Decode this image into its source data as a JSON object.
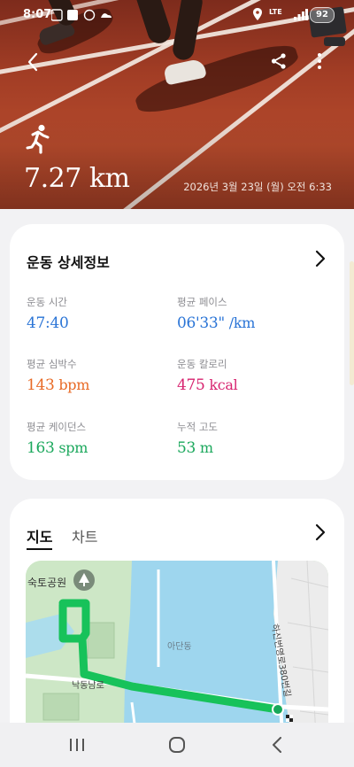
{
  "status_bar": {
    "time": "8:07",
    "battery": "92",
    "network": "LTE"
  },
  "header": {
    "activity_icon": "running-person-icon",
    "distance": "7.27 km",
    "datetime": "2026년 3월 23일 (월) 오전 6:33"
  },
  "details": {
    "title": "운동 상세정보",
    "stats": [
      {
        "label": "운동 시간",
        "value": "47:40",
        "unit": "",
        "color": "#2a74d6"
      },
      {
        "label": "평균 페이스",
        "value": "06'33\"",
        "unit": " /km",
        "color": "#2a74d6"
      },
      {
        "label": "평균 심박수",
        "value": "143",
        "unit": " bpm",
        "color": "#e86a25"
      },
      {
        "label": "운동 칼로리",
        "value": "475",
        "unit": " kcal",
        "color": "#d7236f"
      },
      {
        "label": "평균 케이던스",
        "value": "163",
        "unit": " spm",
        "color": "#1ba85c"
      },
      {
        "label": "누적 고도",
        "value": "53",
        "unit": " m",
        "color": "#1ba85c"
      }
    ]
  },
  "map_card": {
    "tabs": [
      "지도",
      "차트"
    ],
    "active_tab": "지도",
    "labels": {
      "park": "숙토공원",
      "area": "아단동",
      "road1": "낙동남로",
      "road2": "하신번영로380번길"
    }
  },
  "navigation": {
    "recent": "recent-apps-icon",
    "home": "home-icon",
    "back": "back-icon"
  }
}
